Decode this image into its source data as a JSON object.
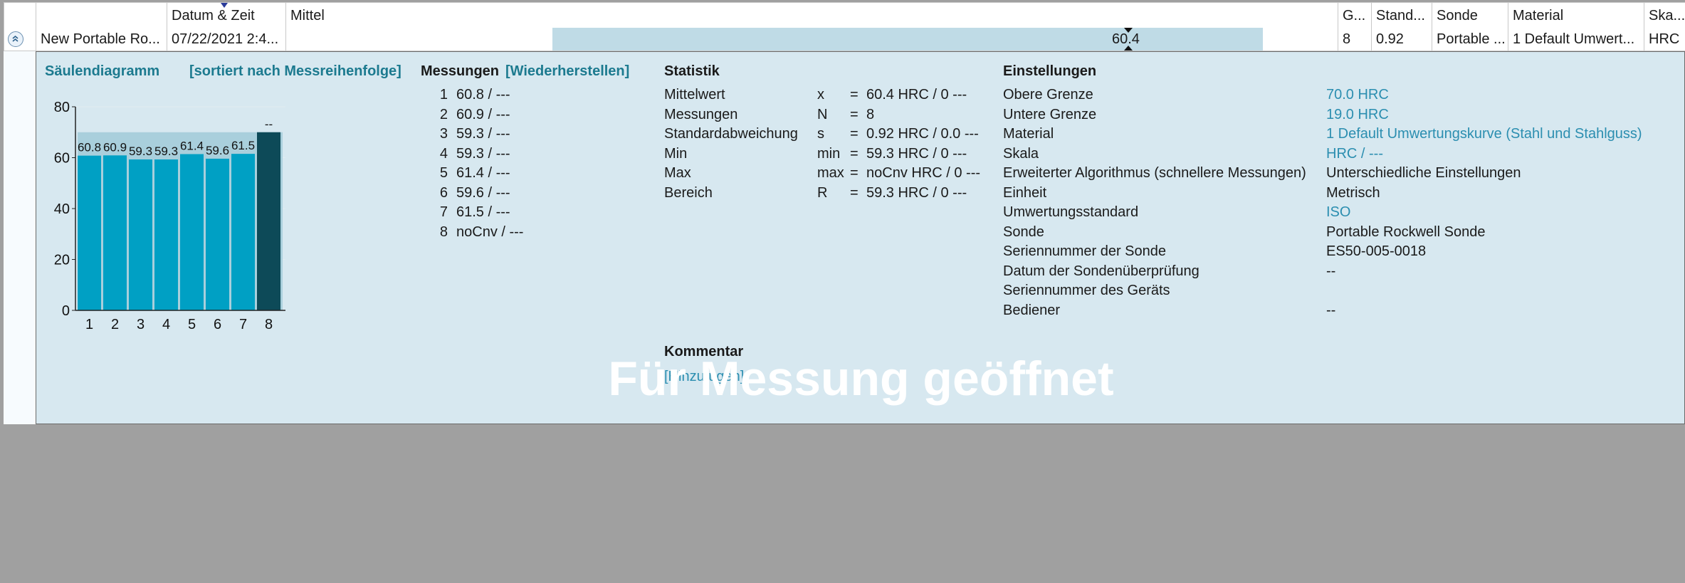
{
  "grid": {
    "columns": [
      "Datum & Zeit",
      "Mittel",
      "G...",
      "Stand...",
      "Sonde",
      "Material",
      "Ska..."
    ],
    "row": {
      "name": "New Portable Ro...",
      "datetime": "07/22/2021 2:4...",
      "mean": "60.4",
      "count": "8",
      "stddev": "0.92",
      "probe": "Portable ...",
      "material": "1 Default Umwert...",
      "scale": "HRC"
    }
  },
  "chart_section": {
    "title": "Säulendiagramm",
    "sort_link": "[sortiert nach Messreihenfolge]"
  },
  "chart_data": {
    "type": "bar",
    "categories": [
      "1",
      "2",
      "3",
      "4",
      "5",
      "6",
      "7",
      "8"
    ],
    "values": [
      60.8,
      60.9,
      59.3,
      59.3,
      61.4,
      59.6,
      61.5,
      null
    ],
    "value_labels": [
      "60.8",
      "60.9",
      "59.3",
      "59.3",
      "61.4",
      "59.6",
      "61.5",
      "--"
    ],
    "yticks": [
      "0",
      "20",
      "40",
      "60",
      "80"
    ],
    "ylim": [
      0,
      80
    ],
    "colors": {
      "bar": "#00a0c4",
      "highlight": "#0d4a58",
      "background_bar": "#a9cfdc"
    },
    "highlight_index": 7
  },
  "measurements": {
    "title": "Messungen",
    "restore": "[Wiederherstellen]",
    "items": [
      {
        "n": "1",
        "v": "60.8 / ---"
      },
      {
        "n": "2",
        "v": "60.9 / ---"
      },
      {
        "n": "3",
        "v": "59.3 / ---"
      },
      {
        "n": "4",
        "v": "59.3 / ---"
      },
      {
        "n": "5",
        "v": "61.4 / ---"
      },
      {
        "n": "6",
        "v": "59.6 / ---"
      },
      {
        "n": "7",
        "v": "61.5 / ---"
      },
      {
        "n": "8",
        "v": "noCnv / ---"
      }
    ]
  },
  "statistics": {
    "title": "Statistik",
    "rows": [
      {
        "label": "Mittelwert",
        "sym": "x",
        "eq": "=",
        "val": "60.4 HRC / 0 ---"
      },
      {
        "label": "Messungen",
        "sym": "N",
        "eq": "=",
        "val": "8"
      },
      {
        "label": "Standardabweichung",
        "sym": "s",
        "eq": "=",
        "val": "0.92 HRC / 0.0 ---"
      },
      {
        "label": "Min",
        "sym": "min",
        "eq": "=",
        "val": "59.3 HRC / 0 ---"
      },
      {
        "label": "Max",
        "sym": "max",
        "eq": "=",
        "val": "noCnv HRC / 0 ---"
      },
      {
        "label": "Bereich",
        "sym": "R",
        "eq": "=",
        "val": "59.3 HRC / 0 ---"
      }
    ]
  },
  "comment": {
    "title": "Kommentar",
    "add": "[Hinzufügen]"
  },
  "settings": {
    "title": "Einstellungen",
    "rows": [
      {
        "label": "Obere Grenze",
        "val": "70.0 HRC",
        "link": true
      },
      {
        "label": "Untere Grenze",
        "val": "19.0 HRC",
        "link": true
      },
      {
        "label": "Material",
        "val": "1 Default Umwertungskurve (Stahl und Stahlguss)",
        "link": true
      },
      {
        "label": "Skala",
        "val": "HRC / ---",
        "link": true
      },
      {
        "label": "Erweiterter Algorithmus (schnellere Messungen)",
        "val": "Unterschiedliche Einstellungen",
        "link": false
      },
      {
        "label": "Einheit",
        "val": "Metrisch",
        "link": false
      },
      {
        "label": "Umwertungsstandard",
        "val": "ISO",
        "link": true
      },
      {
        "label": "Sonde",
        "val": "Portable Rockwell Sonde",
        "link": false
      },
      {
        "label": "Seriennummer der Sonde",
        "val": "ES50-005-0018",
        "link": false
      },
      {
        "label": "Datum der Sondenüberprüfung",
        "val": "--",
        "link": false
      },
      {
        "label": "Seriennummer des Geräts",
        "val": "",
        "link": false
      },
      {
        "label": "Bediener",
        "val": "--",
        "link": false
      }
    ]
  },
  "watermark": "Für Messung geöffnet"
}
